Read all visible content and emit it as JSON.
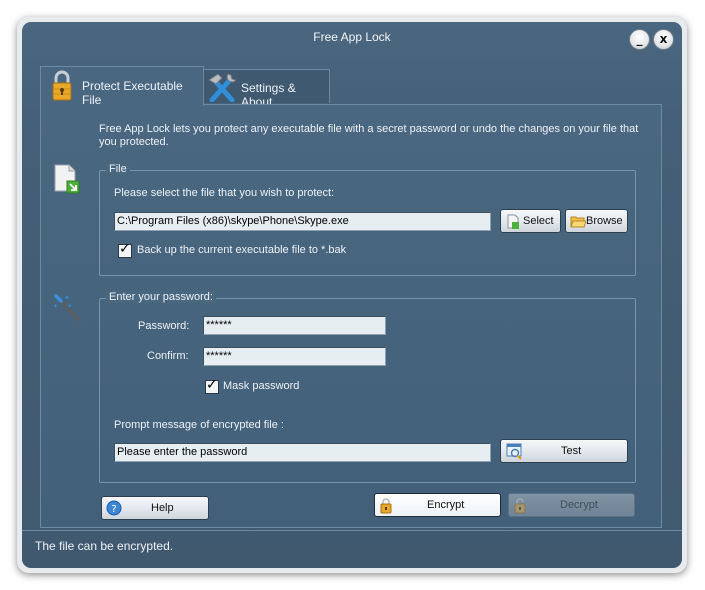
{
  "window": {
    "title": "Free App Lock",
    "minimize_label": "_",
    "close_label": "x"
  },
  "tabs": [
    {
      "label": "Protect Executable File",
      "icon": "padlock-icon",
      "active": true
    },
    {
      "label": "Settings & About",
      "icon": "tools-icon",
      "active": false
    }
  ],
  "intro_text": "Free App Lock lets you protect any executable file with a secret password or undo the changes on your file that you protected.",
  "file_group": {
    "legend": "File",
    "prompt": "Please select the file that you wish to protect:",
    "path_value": "C:\\Program Files (x86)\\skype\\Phone\\Skype.exe",
    "select_label": "Select",
    "browse_label": "Browse",
    "backup_label": "Back up the current executable file to *.bak",
    "backup_checked": true
  },
  "password_group": {
    "legend": "Enter your password:",
    "password_label": "Password:",
    "password_value": "******",
    "confirm_label": "Confirm:",
    "confirm_value": "******",
    "mask_label": "Mask password",
    "mask_checked": true,
    "prompt_label": "Prompt message of encrypted file :",
    "prompt_value": "Please enter the password",
    "test_label": "Test"
  },
  "actions": {
    "help_label": "Help",
    "encrypt_label": "Encrypt",
    "decrypt_label": "Decrypt",
    "decrypt_enabled": false
  },
  "status_text": "The file can be encrypted.",
  "colors": {
    "background": "#445f77",
    "text": "#eef2f6",
    "input_bg": "#e6eef2",
    "lock_gold": "#e8a92a"
  }
}
